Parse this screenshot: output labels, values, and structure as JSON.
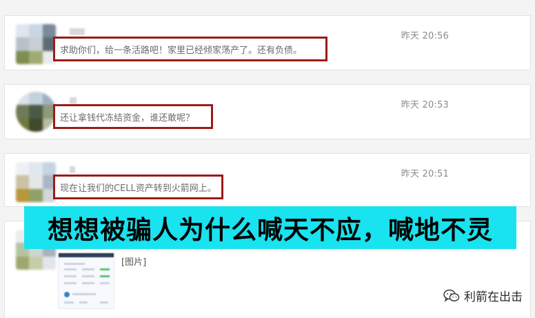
{
  "messages": [
    {
      "time": "昨天 20:56",
      "text": "求助你们，给一条活路吧！家里已经倾家荡产了。还有负债。"
    },
    {
      "time": "昨天 20:53",
      "text": "还让拿钱代冻结资金，谁还敢呢？"
    },
    {
      "time": "昨天 20:51",
      "text": "现在让我们的CELL资产转到火箭网上。"
    },
    {
      "image_label": "[图片]"
    }
  ],
  "banner": {
    "text": "想想被骗人为什么喊天不应，喊地不灵",
    "background": "#19e3ef"
  },
  "watermark": {
    "icon": "wechat-icon",
    "text": "利箭在出击"
  },
  "colors": {
    "highlight_border": "#9b1b17",
    "timestamp": "#8a8a8a"
  }
}
